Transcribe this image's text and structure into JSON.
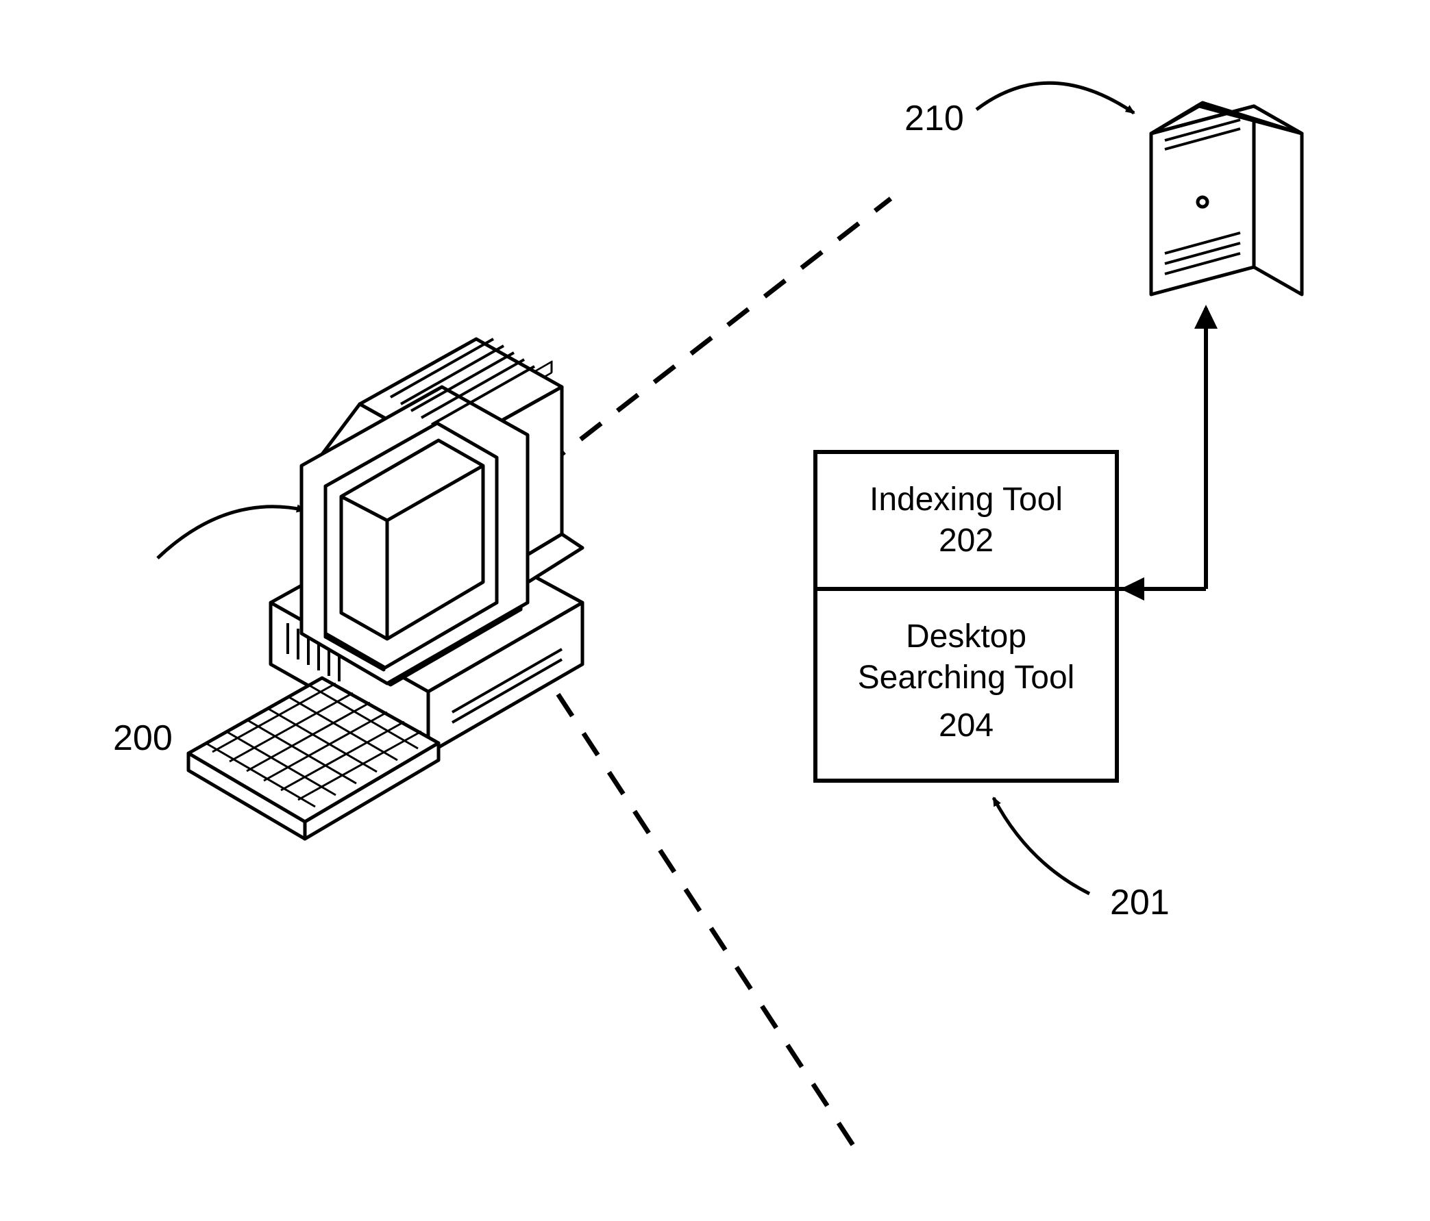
{
  "labels": {
    "computer_ref": "200",
    "toolbox_ref": "201",
    "server_ref": "210",
    "box_top_line1": "Indexing Tool",
    "box_top_line2": "202",
    "box_bot_line1": "Desktop",
    "box_bot_line2": "Searching Tool",
    "box_bot_line3": "204"
  }
}
